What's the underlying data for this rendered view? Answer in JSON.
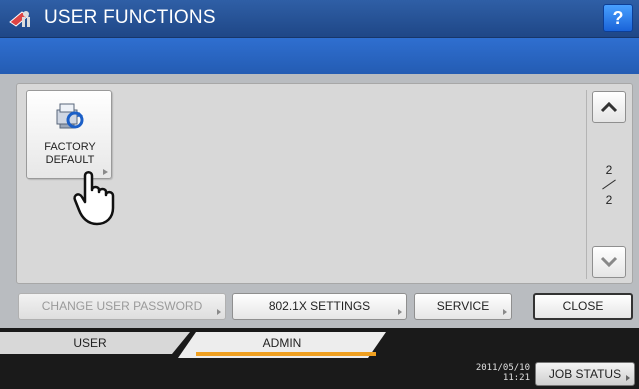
{
  "header": {
    "title": "USER FUNCTIONS",
    "help_label": "?"
  },
  "functions": [
    {
      "label": "FACTORY\nDEFAULT",
      "icon": "factory-default-icon"
    }
  ],
  "pagination": {
    "current": "2",
    "total": "2"
  },
  "actions": {
    "change_password": "CHANGE USER PASSWORD",
    "dot1x": "802.1X SETTINGS",
    "service": "SERVICE",
    "close": "CLOSE"
  },
  "tabs": [
    {
      "label": "USER",
      "active": false
    },
    {
      "label": "ADMIN",
      "active": true
    }
  ],
  "status": {
    "date": "2011/05/10",
    "time": "11:21",
    "job_status": "JOB STATUS"
  },
  "colors": {
    "title_bar": "#1f4787",
    "message_band": "#2f6fd0",
    "active_tab_accent": "#f0a020"
  }
}
